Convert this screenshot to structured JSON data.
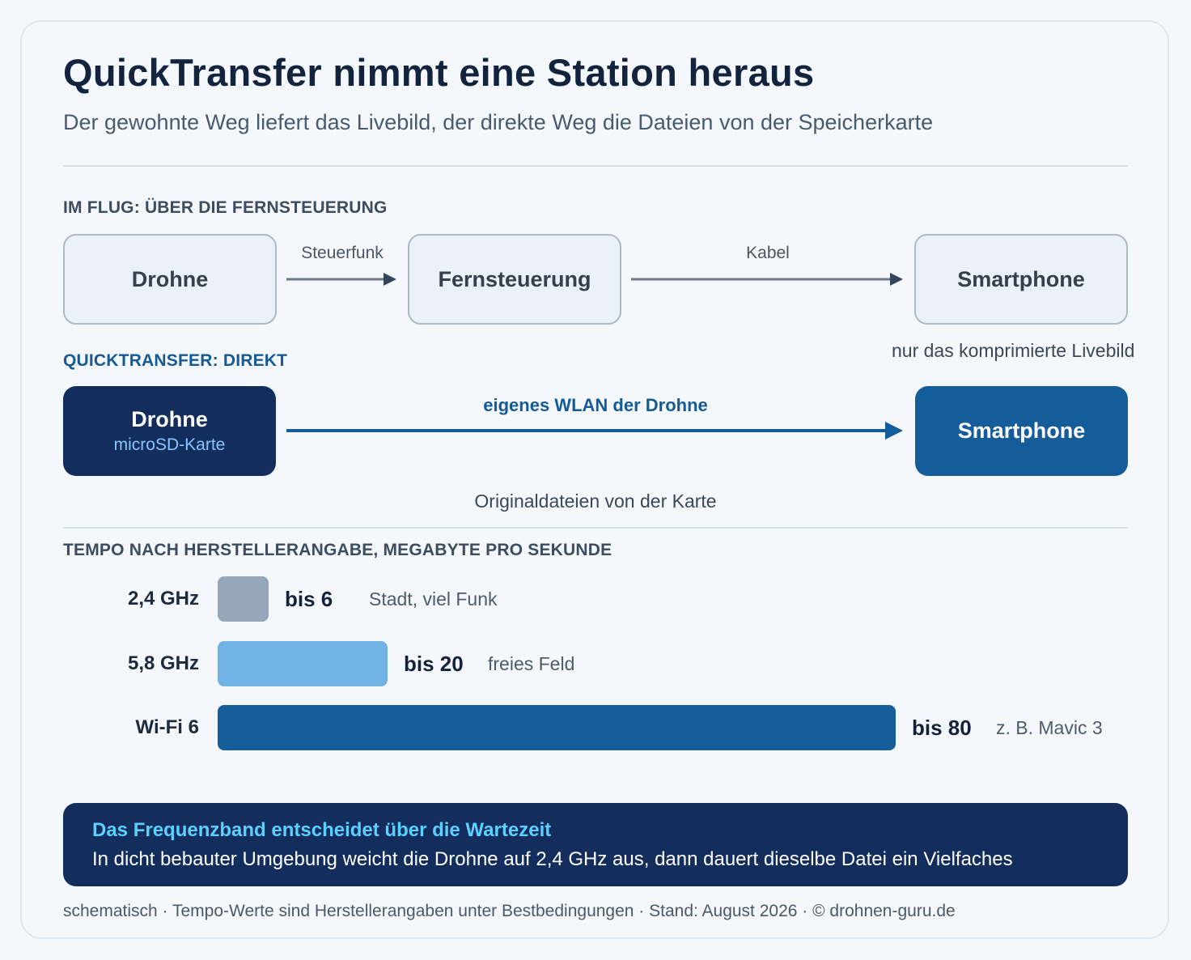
{
  "header": {
    "title": "QuickTransfer nimmt eine Station heraus",
    "subtitle": "Der gewohnte Weg liefert das Livebild, der direkte Weg die Dateien von der Speicherkarte"
  },
  "flight_path": {
    "label": "IM FLUG: ÜBER DIE FERNSTEUERUNG",
    "nodes": [
      "Drohne",
      "Fernsteuerung",
      "Smartphone"
    ],
    "edges": [
      "Steuerfunk",
      "Kabel"
    ],
    "note": "nur das komprimierte Livebild"
  },
  "quicktransfer": {
    "label": "QUICKTRANSFER: DIREKT",
    "source": {
      "title": "Drohne",
      "subtitle": "microSD-Karte"
    },
    "target": "Smartphone",
    "edge": "eigenes WLAN der Drohne",
    "note": "Originaldateien von der Karte"
  },
  "chart_data": {
    "type": "bar",
    "title": "TEMPO NACH HERSTELLERANGABE, MEGABYTE PRO SEKUNDE",
    "categories": [
      "2,4 GHz",
      "5,8 GHz",
      "Wi-Fi 6"
    ],
    "values": [
      6,
      20,
      80
    ],
    "value_labels": [
      "bis 6",
      "bis 20",
      "bis 80"
    ],
    "notes": [
      "Stadt, viel Funk",
      "freies Feld",
      "z. B. Mavic 3"
    ],
    "colors": [
      "#94a6b8",
      "#70b4e6",
      "#155c9a"
    ],
    "xlim": [
      0,
      80
    ],
    "grid": false,
    "orientation": "horizontal"
  },
  "callout": {
    "title": "Das Frequenzband entscheidet über die Wartezeit",
    "text": "In dicht bebauter Umgebung weicht die Drohne auf 2,4 GHz aus, dann dauert dieselbe Datei ein Vielfaches"
  },
  "footer": "schematisch · Tempo-Werte sind Herstellerangaben unter Bestbedingungen · Stand: August 2026 · © drohnen-guru.de",
  "colors": {
    "dark_navy": "#132d5d",
    "mid_blue": "#155c9a",
    "light_blue": "#70b4e6",
    "gray_bar": "#94a6b8",
    "accent_cyan": "#5cd0ff"
  }
}
